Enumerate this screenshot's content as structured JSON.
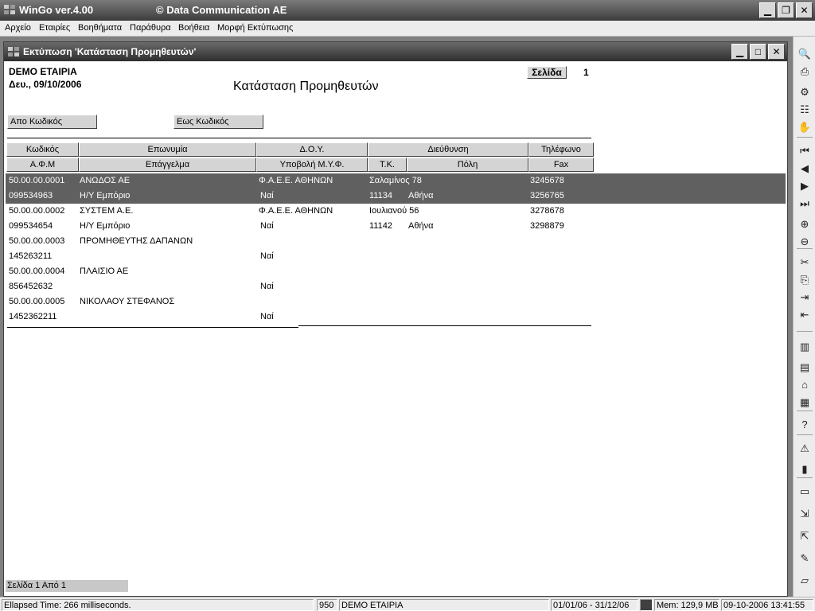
{
  "app": {
    "title": "WinGo ver.4.00",
    "subtitle": "© Data Communication AE",
    "min_glyph": "▁",
    "restore_glyph": "❐",
    "close_glyph": "✕"
  },
  "menu": [
    "Αρχείο",
    "Εταιρίες",
    "Βοηθήματα",
    "Παράθυρα",
    "Βοήθεια",
    "Μορφή Εκτύπωσης"
  ],
  "report_window": {
    "title": "Εκτύπωση 'Κατάσταση Προμηθευτών'",
    "min_glyph": "▁",
    "max_glyph": "□",
    "close_glyph": "✕"
  },
  "report": {
    "company": "DEMO ΕΤΑΙΡΙΑ",
    "date": "Δευ., 09/10/2006",
    "heading": "Κατάσταση Προμηθευτών",
    "page_label": "Σελίδα",
    "page_number": "1",
    "filter_from": "Απο Κωδικός",
    "filter_to": "Εως Κωδικός",
    "headers_row1": [
      "Κωδικός",
      "Επωνυμία",
      "Δ.Ο.Υ.",
      "Διεύθυνση",
      "Τηλέφωνο"
    ],
    "headers_row2": [
      "Α.Φ.Μ",
      "Επάγγελμα",
      "Υποβολή Μ.Υ.Φ.",
      "Τ.Κ.",
      "Πόλη",
      "Fax"
    ],
    "rows": [
      {
        "code": "50.00.00.0001",
        "name": "ΑΝΩΔΟΣ ΑΕ",
        "doy": "Φ.Α.Ε.Ε. ΑΘΗΝΩΝ",
        "address": "Σαλαμίνος 78",
        "phone": "3245678",
        "afm": "099534963",
        "profession": "Η/Υ Εμπόριο",
        "myf": "Ναί",
        "tk": "11134",
        "city": "Αθήνα",
        "fax": "3256765"
      },
      {
        "code": "50.00.00.0002",
        "name": "ΣΥΣΤΕΜ Α.Ε.",
        "doy": "Φ.Α.Ε.Ε. ΑΘΗΝΩΝ",
        "address": "Ιουλιανού 56",
        "phone": "3278678",
        "afm": "099534654",
        "profession": "Η/Υ Εμπόριο",
        "myf": "Ναί",
        "tk": "11142",
        "city": "Αθήνα",
        "fax": "3298879"
      },
      {
        "code": "50.00.00.0003",
        "name": "ΠΡΟΜΗΘΕΥΤΗΣ ΔΑΠΑΝΩΝ",
        "doy": "",
        "address": "",
        "phone": "",
        "afm": "145263211",
        "profession": "",
        "myf": "Ναί",
        "tk": "",
        "city": "",
        "fax": ""
      },
      {
        "code": "50.00.00.0004",
        "name": "ΠΛΑΙΣΙΟ ΑΕ",
        "doy": "",
        "address": "",
        "phone": "",
        "afm": "856452632",
        "profession": "",
        "myf": "Ναί",
        "tk": "",
        "city": "",
        "fax": ""
      },
      {
        "code": "50.00.00.0005",
        "name": "ΝΙΚΟΛΑΟΥ ΣΤΕΦΑΝΟΣ",
        "doy": "",
        "address": "",
        "phone": "",
        "afm": "1452362211",
        "profession": "",
        "myf": "Ναί",
        "tk": "",
        "city": "",
        "fax": ""
      }
    ],
    "page_status": "Σελίδα 1 Από 1"
  },
  "toolbar_icons": [
    {
      "name": "preview-zoom-icon",
      "glyph": "🔍"
    },
    {
      "name": "printer-icon",
      "glyph": "⎙"
    },
    {
      "name": "printer-setup-icon",
      "glyph": "⚙"
    },
    {
      "name": "tree-icon",
      "glyph": "☷"
    },
    {
      "name": "stop-hand-icon",
      "glyph": "✋"
    },
    {
      "name": "first-page-icon",
      "glyph": "⏮"
    },
    {
      "name": "prev-page-icon",
      "glyph": "◀"
    },
    {
      "name": "next-page-icon",
      "glyph": "▶"
    },
    {
      "name": "last-page-icon",
      "glyph": "⏭"
    },
    {
      "name": "zoom-in-icon",
      "glyph": "⊕"
    },
    {
      "name": "zoom-out-icon",
      "glyph": "⊖"
    },
    {
      "name": "cut-icon",
      "glyph": "✂"
    },
    {
      "name": "copy-icon",
      "glyph": "⎘"
    },
    {
      "name": "indent-icon",
      "glyph": "⇥"
    },
    {
      "name": "outdent-icon",
      "glyph": "⇤"
    },
    {
      "name": "columns-icon",
      "glyph": "▥"
    },
    {
      "name": "form-icon",
      "glyph": "▤"
    },
    {
      "name": "bank-icon",
      "glyph": "⌂"
    },
    {
      "name": "calculator-icon",
      "glyph": "▦"
    },
    {
      "name": "help-icon",
      "glyph": "?"
    },
    {
      "name": "warning-icon",
      "glyph": "⚠"
    },
    {
      "name": "chart-icon",
      "glyph": "▮"
    },
    {
      "name": "window-icon",
      "glyph": "▭"
    },
    {
      "name": "login-icon",
      "glyph": "⇲"
    },
    {
      "name": "logout-icon",
      "glyph": "⇱"
    },
    {
      "name": "edit-icon",
      "glyph": "✎"
    },
    {
      "name": "folder-icon",
      "glyph": "▱"
    }
  ],
  "statusbar": {
    "elapsed": "Ellapsed Time: 266 milliseconds.",
    "company_id": "950",
    "company_name": "DEMO ΕΤΑΙΡΙΑ",
    "period": "01/01/06 - 31/12/06",
    "memory": "Mem: 129,9 MB",
    "datetime": "09-10-2006 13:41:55"
  }
}
